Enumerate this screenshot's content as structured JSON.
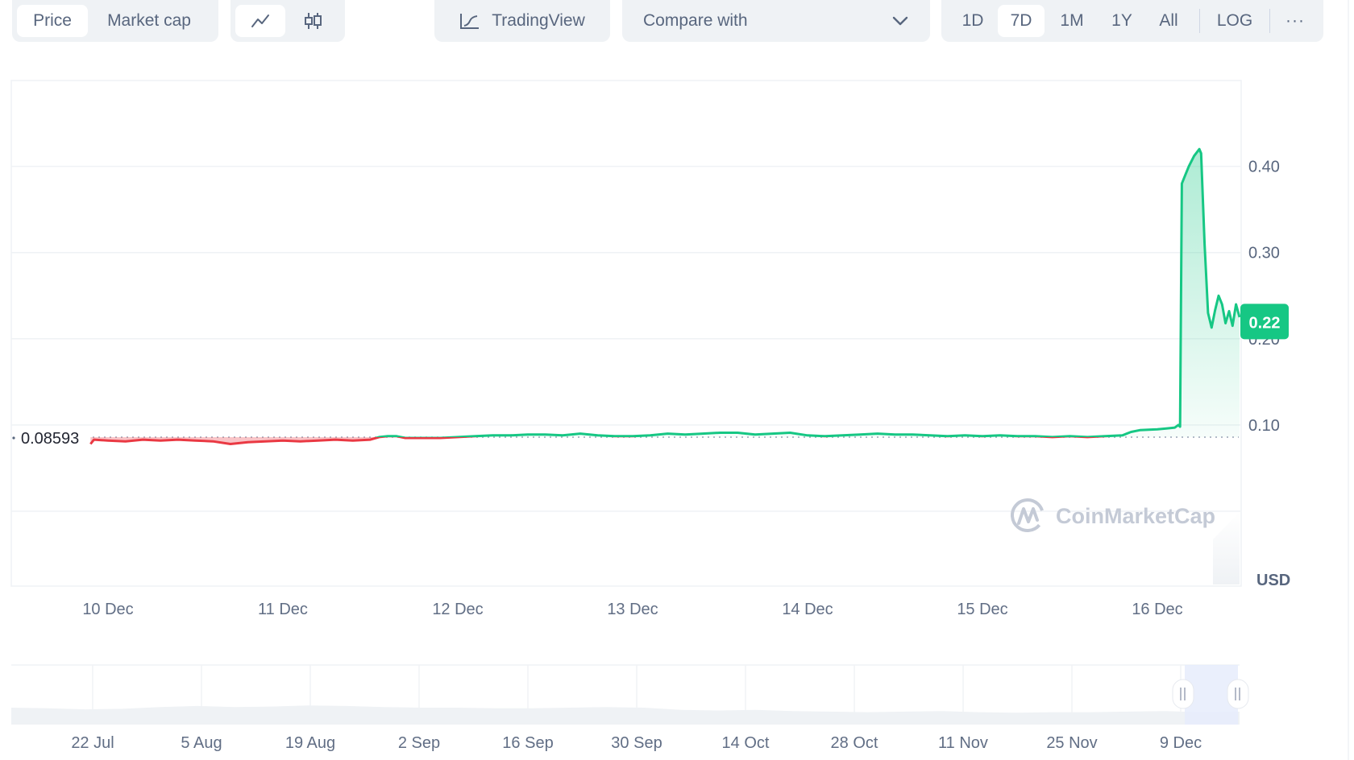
{
  "toolbar": {
    "type_tabs": [
      {
        "label": "Price",
        "active": true
      },
      {
        "label": "Market cap",
        "active": false
      }
    ],
    "chart_style": [
      {
        "icon": "line-chart-icon",
        "active": true
      },
      {
        "icon": "candlestick-icon",
        "active": false
      }
    ],
    "tradingview_label": "TradingView",
    "compare_label": "Compare with",
    "ranges": [
      {
        "label": "1D",
        "active": false
      },
      {
        "label": "7D",
        "active": true
      },
      {
        "label": "1M",
        "active": false
      },
      {
        "label": "1Y",
        "active": false
      },
      {
        "label": "All",
        "active": false
      }
    ],
    "log_label": "LOG",
    "more_label": "···"
  },
  "colors": {
    "up": "#16c784",
    "down": "#ea3943",
    "grid": "#eff2f5",
    "navigator_fill": "#eff2f5",
    "navigator_selection": "#e6ecfb"
  },
  "chart_data": {
    "type": "line",
    "title": "",
    "currency_label": "USD",
    "watermark": "CoinMarketCap",
    "ylim": [
      0,
      0.5
    ],
    "yticks": [
      "0.10",
      "0.20",
      "0.30",
      "0.40"
    ],
    "ytick_values": [
      0.1,
      0.2,
      0.3,
      0.4
    ],
    "baseline_value": 0.08593,
    "baseline_label": "0.08593",
    "current_price_label": "0.22",
    "current_price": 0.22,
    "x_labels": [
      "10 Dec",
      "11 Dec",
      "12 Dec",
      "13 Dec",
      "14 Dec",
      "15 Dec",
      "16 Dec"
    ],
    "x_range_days": [
      9.9,
      16.6
    ],
    "series": [
      {
        "name": "Price",
        "points": [
          [
            9.9,
            0.078
          ],
          [
            9.92,
            0.083
          ],
          [
            10.0,
            0.082
          ],
          [
            10.1,
            0.081
          ],
          [
            10.2,
            0.083
          ],
          [
            10.3,
            0.082
          ],
          [
            10.4,
            0.083
          ],
          [
            10.5,
            0.082
          ],
          [
            10.6,
            0.081
          ],
          [
            10.7,
            0.078
          ],
          [
            10.8,
            0.08
          ],
          [
            10.9,
            0.081
          ],
          [
            11.0,
            0.082
          ],
          [
            11.1,
            0.081
          ],
          [
            11.2,
            0.082
          ],
          [
            11.3,
            0.083
          ],
          [
            11.4,
            0.082
          ],
          [
            11.5,
            0.083
          ],
          [
            11.55,
            0.086
          ],
          [
            11.6,
            0.087
          ],
          [
            11.65,
            0.087
          ],
          [
            11.7,
            0.085
          ],
          [
            11.8,
            0.085
          ],
          [
            11.9,
            0.085
          ],
          [
            12.0,
            0.086
          ],
          [
            12.1,
            0.087
          ],
          [
            12.2,
            0.088
          ],
          [
            12.3,
            0.088
          ],
          [
            12.4,
            0.089
          ],
          [
            12.5,
            0.089
          ],
          [
            12.6,
            0.088
          ],
          [
            12.7,
            0.09
          ],
          [
            12.8,
            0.088
          ],
          [
            12.9,
            0.087
          ],
          [
            13.0,
            0.087
          ],
          [
            13.1,
            0.088
          ],
          [
            13.2,
            0.09
          ],
          [
            13.3,
            0.089
          ],
          [
            13.4,
            0.09
          ],
          [
            13.5,
            0.091
          ],
          [
            13.6,
            0.091
          ],
          [
            13.7,
            0.089
          ],
          [
            13.8,
            0.09
          ],
          [
            13.9,
            0.091
          ],
          [
            14.0,
            0.088
          ],
          [
            14.1,
            0.087
          ],
          [
            14.2,
            0.088
          ],
          [
            14.3,
            0.089
          ],
          [
            14.4,
            0.09
          ],
          [
            14.5,
            0.089
          ],
          [
            14.6,
            0.089
          ],
          [
            14.7,
            0.088
          ],
          [
            14.8,
            0.087
          ],
          [
            14.9,
            0.088
          ],
          [
            15.0,
            0.087
          ],
          [
            15.1,
            0.088
          ],
          [
            15.2,
            0.087
          ],
          [
            15.3,
            0.087
          ],
          [
            15.4,
            0.086
          ],
          [
            15.5,
            0.087
          ],
          [
            15.6,
            0.086
          ],
          [
            15.7,
            0.087
          ],
          [
            15.8,
            0.088
          ],
          [
            15.85,
            0.092
          ],
          [
            15.9,
            0.094
          ],
          [
            16.0,
            0.095
          ],
          [
            16.05,
            0.096
          ],
          [
            16.1,
            0.097
          ],
          [
            16.12,
            0.1
          ],
          [
            16.13,
            0.098
          ],
          [
            16.14,
            0.38
          ],
          [
            16.16,
            0.39
          ],
          [
            16.18,
            0.4
          ],
          [
            16.21,
            0.412
          ],
          [
            16.24,
            0.42
          ],
          [
            16.25,
            0.415
          ],
          [
            16.27,
            0.31
          ],
          [
            16.29,
            0.23
          ],
          [
            16.31,
            0.213
          ],
          [
            16.33,
            0.233
          ],
          [
            16.35,
            0.25
          ],
          [
            16.37,
            0.24
          ],
          [
            16.39,
            0.218
          ],
          [
            16.41,
            0.232
          ],
          [
            16.43,
            0.215
          ],
          [
            16.45,
            0.24
          ],
          [
            16.47,
            0.225
          ]
        ]
      }
    ],
    "navigator": {
      "x_labels": [
        "22 Jul",
        "5 Aug",
        "19 Aug",
        "2 Sep",
        "16 Sep",
        "30 Sep",
        "14 Oct",
        "28 Oct",
        "11 Nov",
        "25 Nov",
        "9 Dec"
      ],
      "selection": "last 7 days",
      "values": [
        0.3,
        0.29,
        0.27,
        0.28,
        0.31,
        0.33,
        0.31,
        0.32,
        0.34,
        0.33,
        0.31,
        0.3,
        0.3,
        0.29,
        0.29,
        0.3,
        0.31,
        0.3,
        0.26,
        0.25,
        0.26,
        0.24,
        0.23,
        0.22,
        0.23,
        0.24,
        0.22,
        0.21,
        0.22,
        0.22,
        0.23,
        0.24,
        0.22,
        0.23
      ]
    }
  }
}
